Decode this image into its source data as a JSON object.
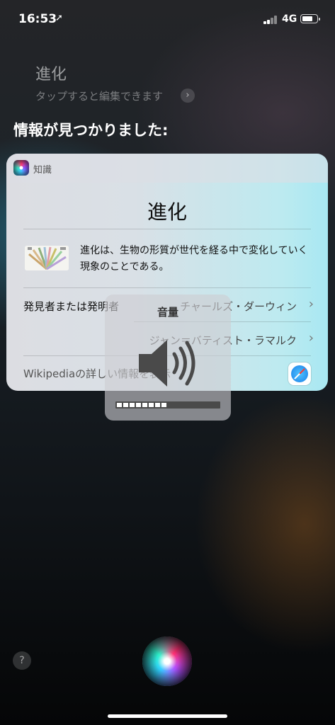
{
  "status_bar": {
    "time": "16:53",
    "location_glyph": "➚",
    "network": "4G",
    "battery_level": 0.75
  },
  "siri": {
    "query": "進化",
    "edit_hint": "タップすると編集できます",
    "found_text": "情報が見つかりました:"
  },
  "card": {
    "app_name": "知識",
    "title": "進化",
    "description": "進化は、生物の形質が世代を経る中で変化していく現象のことである。",
    "discoverer_label": "発見者または発明者",
    "discoverers": [
      "チャールズ・ダーウィン",
      "ジャン＝バティスト・ラマルク"
    ],
    "wiki_link": "Wikipediaの詳しい情報を表示"
  },
  "volume_hud": {
    "title": "音量",
    "level": 0.5
  },
  "icons": {
    "help": "?",
    "chevron": "›"
  }
}
